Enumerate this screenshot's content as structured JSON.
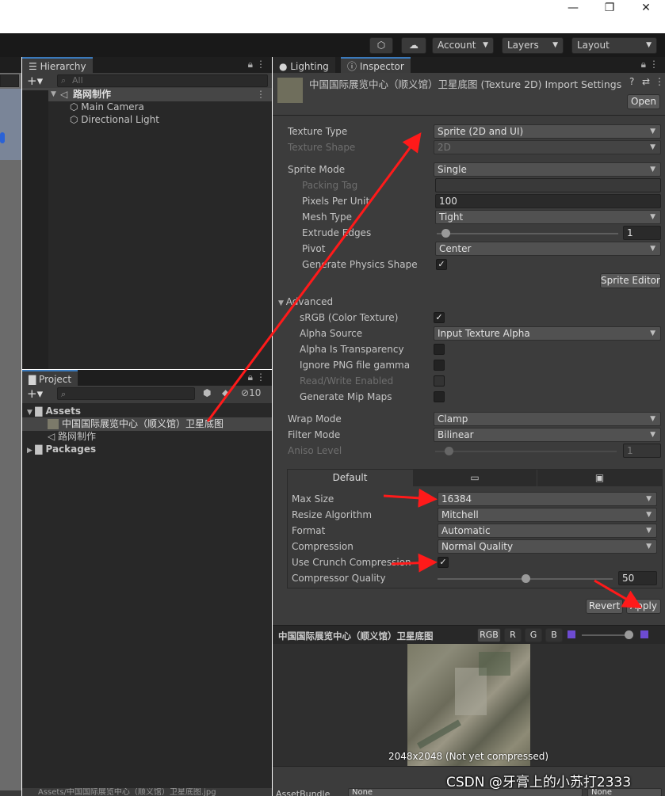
{
  "window": {
    "minimize": "—",
    "restore": "❐",
    "close": "✕"
  },
  "toolbar": {
    "account": "Account",
    "layers": "Layers",
    "layout": "Layout"
  },
  "hierarchy": {
    "tab": "Hierarchy",
    "search_placeholder": "All",
    "scene": "路网制作",
    "items": [
      "Main Camera",
      "Directional Light"
    ]
  },
  "project": {
    "tab": "Project",
    "hidden_count": "10",
    "assets": "Assets",
    "asset_items": [
      "中国国际展览中心（顺义馆）卫星底图",
      "路网制作"
    ],
    "packages": "Packages",
    "path": "Assets/中国国际展览中心（顺义馆）卫星底图.jpg"
  },
  "inspector": {
    "tabs": [
      "Lighting",
      "Inspector"
    ],
    "title": "中国国际展览中心（顺义馆）卫星底图 (Texture 2D) Import Settings",
    "open_label": "Open",
    "texture_type": {
      "label": "Texture Type",
      "value": "Sprite (2D and UI)"
    },
    "texture_shape": {
      "label": "Texture Shape",
      "value": "2D"
    },
    "sprite_mode": {
      "label": "Sprite Mode",
      "value": "Single"
    },
    "packing_tag": {
      "label": "Packing Tag",
      "value": ""
    },
    "pixels_per_unit": {
      "label": "Pixels Per Unit",
      "value": "100"
    },
    "mesh_type": {
      "label": "Mesh Type",
      "value": "Tight"
    },
    "extrude_edges": {
      "label": "Extrude Edges",
      "value": "1"
    },
    "pivot": {
      "label": "Pivot",
      "value": "Center"
    },
    "gen_physics": {
      "label": "Generate Physics Shape",
      "checked": true
    },
    "sprite_editor": "Sprite Editor",
    "advanced": "Advanced",
    "srgb": {
      "label": "sRGB (Color Texture)",
      "checked": true
    },
    "alpha_source": {
      "label": "Alpha Source",
      "value": "Input Texture Alpha"
    },
    "alpha_transparency": {
      "label": "Alpha Is Transparency"
    },
    "ignore_png": {
      "label": "Ignore PNG file gamma"
    },
    "read_write": {
      "label": "Read/Write Enabled"
    },
    "mip_maps": {
      "label": "Generate Mip Maps"
    },
    "wrap_mode": {
      "label": "Wrap Mode",
      "value": "Clamp"
    },
    "filter_mode": {
      "label": "Filter Mode",
      "value": "Bilinear"
    },
    "aniso_level": {
      "label": "Aniso Level",
      "value": "1"
    },
    "platform_tab": "Default",
    "max_size": {
      "label": "Max Size",
      "value": "16384"
    },
    "resize_algorithm": {
      "label": "Resize Algorithm",
      "value": "Mitchell"
    },
    "format": {
      "label": "Format",
      "value": "Automatic"
    },
    "compression": {
      "label": "Compression",
      "value": "Normal Quality"
    },
    "crunch": {
      "label": "Use Crunch Compression",
      "checked": true
    },
    "compressor_quality": {
      "label": "Compressor Quality",
      "value": "50"
    },
    "revert": "Revert",
    "apply": "Apply",
    "preview_title": "中国国际展览中心（顺义馆）卫星底图",
    "channels": [
      "RGB",
      "R",
      "G",
      "B"
    ],
    "preview_info": "2048x2048 (Not yet compressed)",
    "asset_bundle_label": "AssetBundle",
    "asset_bundle_value": "None",
    "asset_variant_value": "None"
  },
  "watermark": "CSDN @牙膏上的小苏打2333",
  "colors": {
    "accent": "#3a79bb",
    "arrow": "#ff1a1a"
  }
}
